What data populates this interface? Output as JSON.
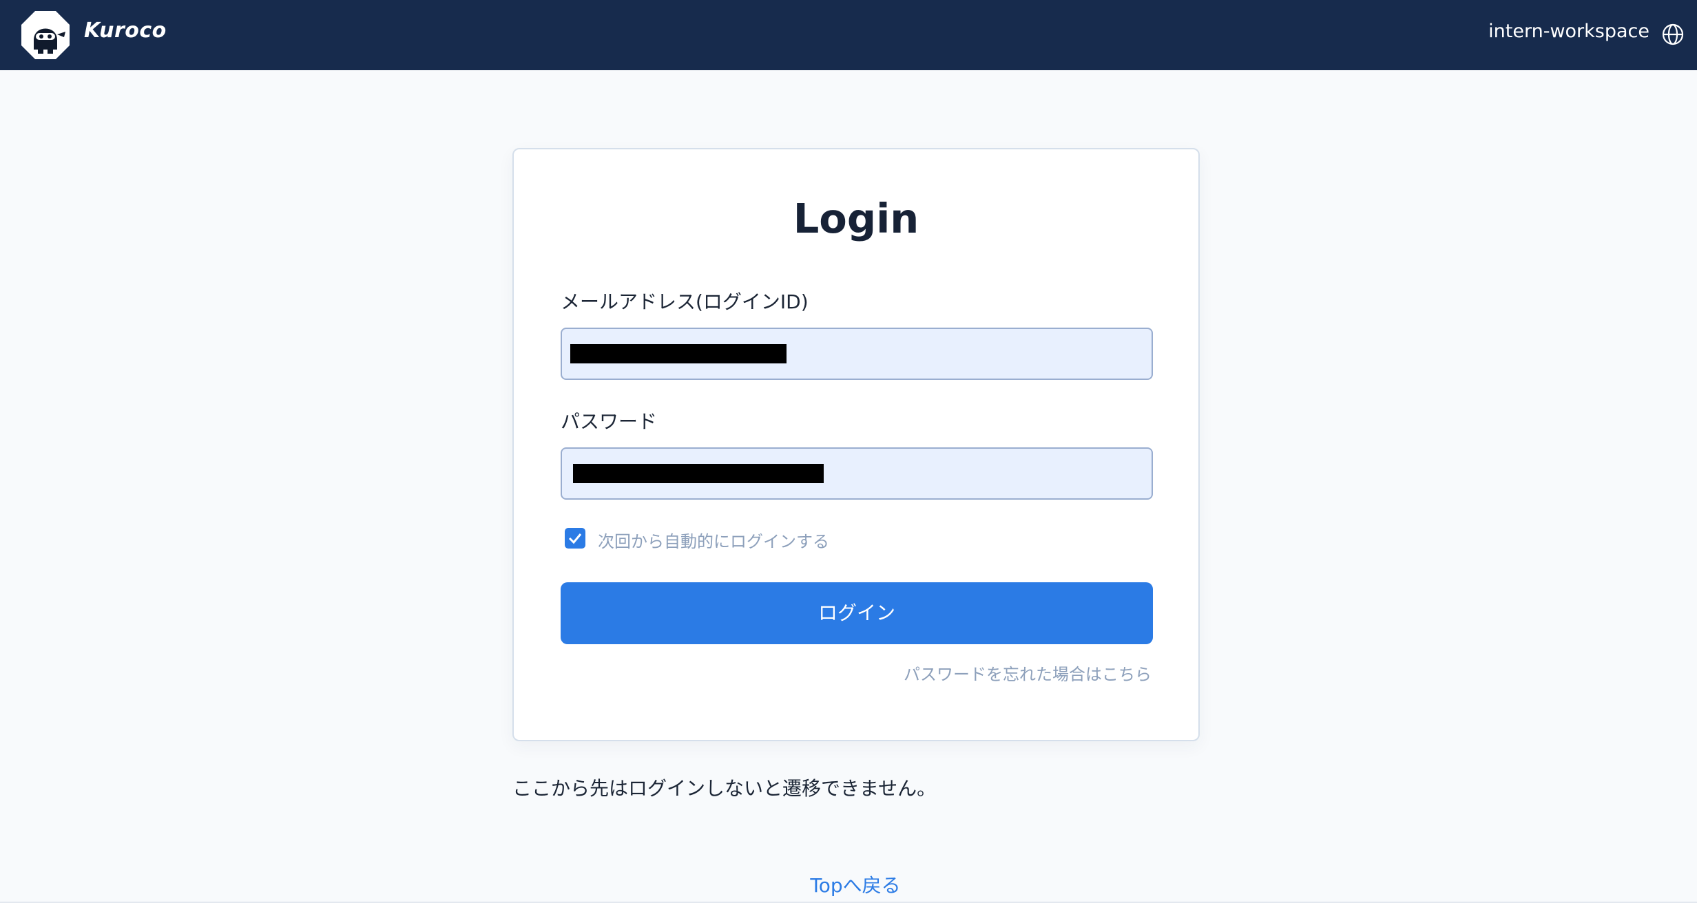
{
  "header": {
    "brand": "Kuroco",
    "workspace": "intern-workspace",
    "logo_icon": "ninja-mascot-icon",
    "language_icon": "globe-icon",
    "background_color": "#172b4d"
  },
  "login": {
    "title": "Login",
    "email_label": "メールアドレス(ログインID)",
    "password_label": "パスワード",
    "remember_label": "次回から自動的にログインする",
    "remember_checked": true,
    "submit_label": "ログイン",
    "forgot_label": "パスワードを忘れた場合はこちら"
  },
  "footer": {
    "notice": "ここから先はログインしないと遷移できません。",
    "top_link": "Topへ戻る"
  },
  "colors": {
    "accent": "#2b7be5",
    "muted_text": "#8da0bb",
    "input_background": "#e8f0fe"
  }
}
